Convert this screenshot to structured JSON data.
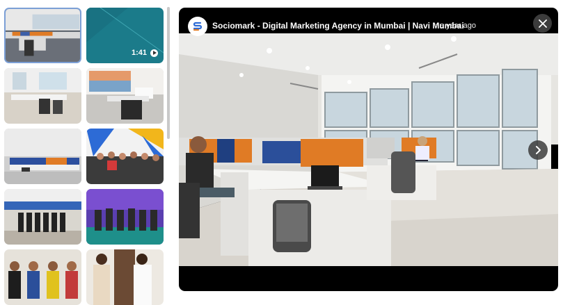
{
  "viewer": {
    "title": "Sociomark - Digital Marketing Agency in Mumbai | Navi Mumbai",
    "separator": "·",
    "time_ago": "a year ago",
    "avatar_icon": "sociomark-logo-icon",
    "close_icon": "close-icon",
    "next_icon": "chevron-right-icon"
  },
  "thumbnails": [
    {
      "name": "office-photo",
      "selected": true
    },
    {
      "name": "video",
      "duration": "1:41",
      "icon": "play-icon"
    },
    {
      "name": "office-photo"
    },
    {
      "name": "office-photo"
    },
    {
      "name": "office-photo"
    },
    {
      "name": "team-photo"
    },
    {
      "name": "team-photo"
    },
    {
      "name": "team-photo"
    },
    {
      "name": "team-photo"
    },
    {
      "name": "team-photo"
    }
  ],
  "colors": {
    "accent_border": "#7b9fd6",
    "viewer_bg": "#000000",
    "video_thumb": "#1c7a8a"
  }
}
